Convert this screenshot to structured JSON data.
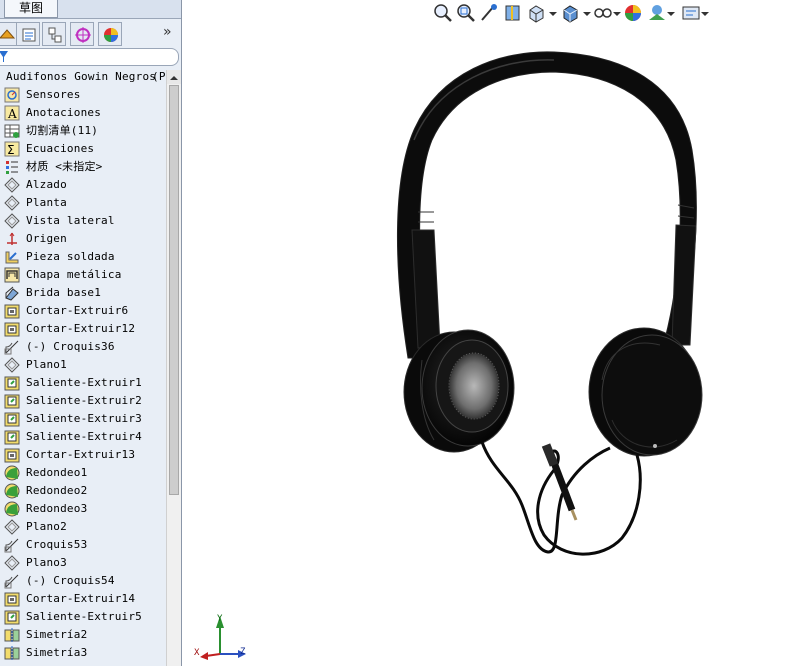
{
  "sketch_tab": "草图",
  "tree": {
    "root": "Audifonos Gowin Negros",
    "root_suffix": "(P:",
    "items": [
      {
        "label": "Sensores",
        "icon": "sensor-icon"
      },
      {
        "label": "Anotaciones",
        "icon": "annotation-icon"
      },
      {
        "label": "切割清单(11)",
        "icon": "cut-list-icon"
      },
      {
        "label": "Ecuaciones",
        "icon": "equation-icon"
      },
      {
        "label": "材质 <未指定>",
        "icon": "material-icon"
      },
      {
        "label": "Alzado",
        "icon": "plane-icon"
      },
      {
        "label": "Planta",
        "icon": "plane-icon"
      },
      {
        "label": "Vista lateral",
        "icon": "plane-icon"
      },
      {
        "label": "Origen",
        "icon": "origin-icon"
      },
      {
        "label": "Pieza soldada",
        "icon": "weldment-icon"
      },
      {
        "label": "Chapa metálica",
        "icon": "sheet-metal-icon"
      },
      {
        "label": "Brida base1",
        "icon": "base-flange-icon"
      },
      {
        "label": "Cortar-Extruir6",
        "icon": "cut-extrude-icon"
      },
      {
        "label": "Cortar-Extruir12",
        "icon": "cut-extrude-icon"
      },
      {
        "label": "(-) Croquis36",
        "icon": "sketch-icon"
      },
      {
        "label": "Plano1",
        "icon": "plane-icon"
      },
      {
        "label": "Saliente-Extruir1",
        "icon": "boss-extrude-icon"
      },
      {
        "label": "Saliente-Extruir2",
        "icon": "boss-extrude-icon"
      },
      {
        "label": "Saliente-Extruir3",
        "icon": "boss-extrude-icon"
      },
      {
        "label": "Saliente-Extruir4",
        "icon": "boss-extrude-icon"
      },
      {
        "label": "Cortar-Extruir13",
        "icon": "cut-extrude-icon"
      },
      {
        "label": "Redondeo1",
        "icon": "fillet-icon"
      },
      {
        "label": "Redondeo2",
        "icon": "fillet-icon"
      },
      {
        "label": "Redondeo3",
        "icon": "fillet-icon"
      },
      {
        "label": "Plano2",
        "icon": "plane-icon"
      },
      {
        "label": "Croquis53",
        "icon": "sketch-icon"
      },
      {
        "label": "Plano3",
        "icon": "plane-icon"
      },
      {
        "label": "(-) Croquis54",
        "icon": "sketch-icon"
      },
      {
        "label": "Cortar-Extruir14",
        "icon": "cut-extrude-icon"
      },
      {
        "label": "Saliente-Extruir5",
        "icon": "boss-extrude-icon"
      },
      {
        "label": "Simetría2",
        "icon": "mirror-icon"
      },
      {
        "label": "Simetría3",
        "icon": "mirror-icon"
      }
    ]
  },
  "triad": {
    "x": "X",
    "y": "Y",
    "z": "Z"
  }
}
